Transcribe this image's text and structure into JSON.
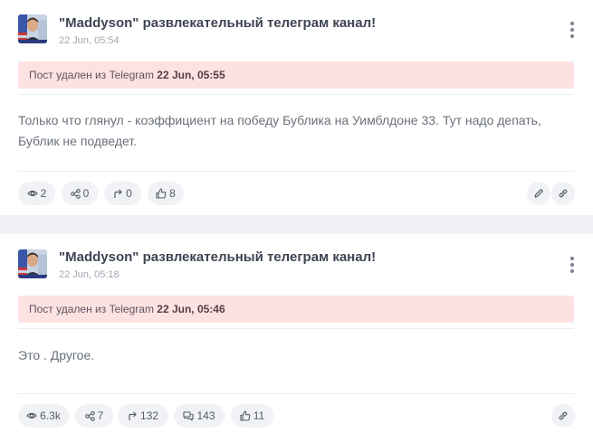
{
  "colors": {
    "page_bg": "#f0f1f4",
    "card_bg": "#ffffff",
    "notice_bg": "#fde2e2",
    "chip_bg": "#f1f2f5"
  },
  "posts": [
    {
      "channel_name": "\"Maddyson\" развлекательный телеграм канал!",
      "date": "22 Jun, 05:54",
      "notice_prefix": "Пост удален из Telegram",
      "notice_time": "22 Jun, 05:55",
      "text_lines": [
        "Только что глянул - коэффициент на победу Бублика на Уимблдоне 33. Тут надо депать,",
        "Бублик не подведет."
      ],
      "stats": {
        "views": "2",
        "shares": "0",
        "forwards": "0",
        "likes": "8"
      },
      "actions": [
        "edit-icon",
        "link-icon"
      ]
    },
    {
      "channel_name": "\"Maddyson\" развлекательный телеграм канал!",
      "date": "22 Jun, 05:18",
      "notice_prefix": "Пост удален из Telegram",
      "notice_time": "22 Jun, 05:46",
      "text_lines": [
        "Это . Другое."
      ],
      "stats": {
        "views": "6.3k",
        "shares": "7",
        "forwards": "132",
        "comments": "143",
        "likes": "11"
      },
      "actions": [
        "link-icon"
      ]
    }
  ]
}
